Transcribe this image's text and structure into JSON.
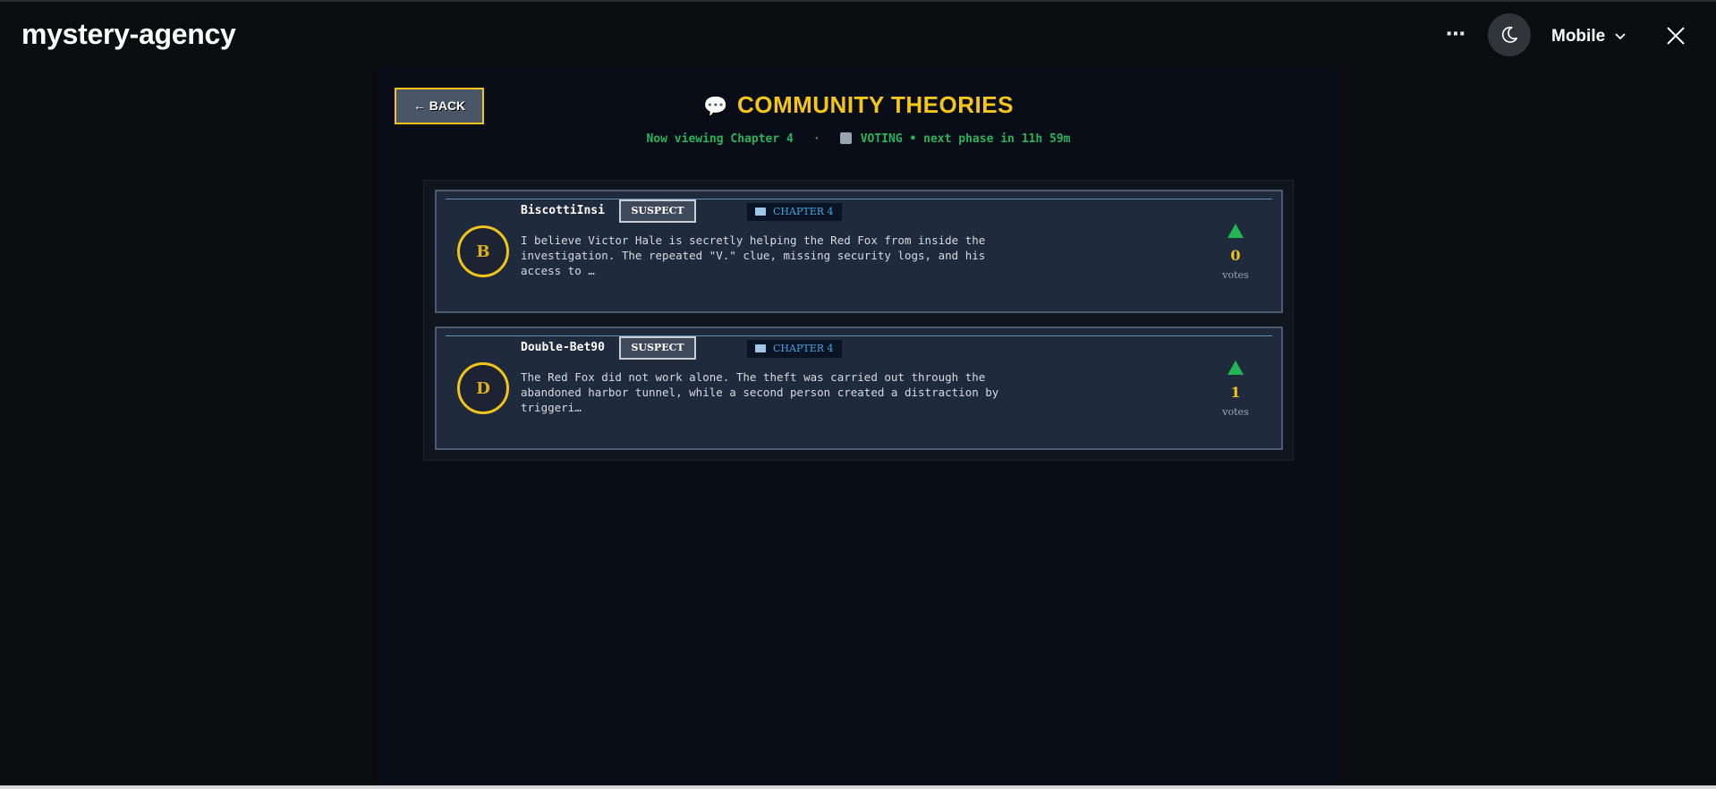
{
  "window": {
    "title": "mystery-agency",
    "more_label": "⋯",
    "device_label": "Mobile",
    "icons": [
      "more-icon",
      "moon-icon",
      "chevron-down-icon",
      "close-icon"
    ]
  },
  "page": {
    "back_label": "← BACK",
    "title": "COMMUNITY THEORIES",
    "title_icon": "speech-bubble-icon",
    "chapter_status": "Now viewing Chapter 4",
    "separator": "·",
    "phase_status": "VOTING • next phase in 11h 59m"
  },
  "theories": [
    {
      "avatar_letter": "B",
      "author": "BiscottiInsi",
      "badge": "SUSPECT",
      "chapter": "CHAPTER 4",
      "text": "I believe Victor Hale is secretly helping the Red Fox from inside the\ninvestigation. The repeated \"V.\" clue, missing security logs, and his\naccess to …",
      "votes": "0",
      "votes_label": "votes"
    },
    {
      "avatar_letter": "D",
      "author": "Double-Bet90",
      "badge": "SUSPECT",
      "chapter": "CHAPTER 4",
      "text": "The Red Fox did not work alone. The theft was carried out through the\nabandoned harbor tunnel, while a second person created a distraction by\ntriggeri…",
      "votes": "1",
      "votes_label": "votes"
    }
  ],
  "colors": {
    "accent_yellow": "#f5c518",
    "status_green": "#27b35a",
    "chapter_blue": "#3fa7e0"
  }
}
